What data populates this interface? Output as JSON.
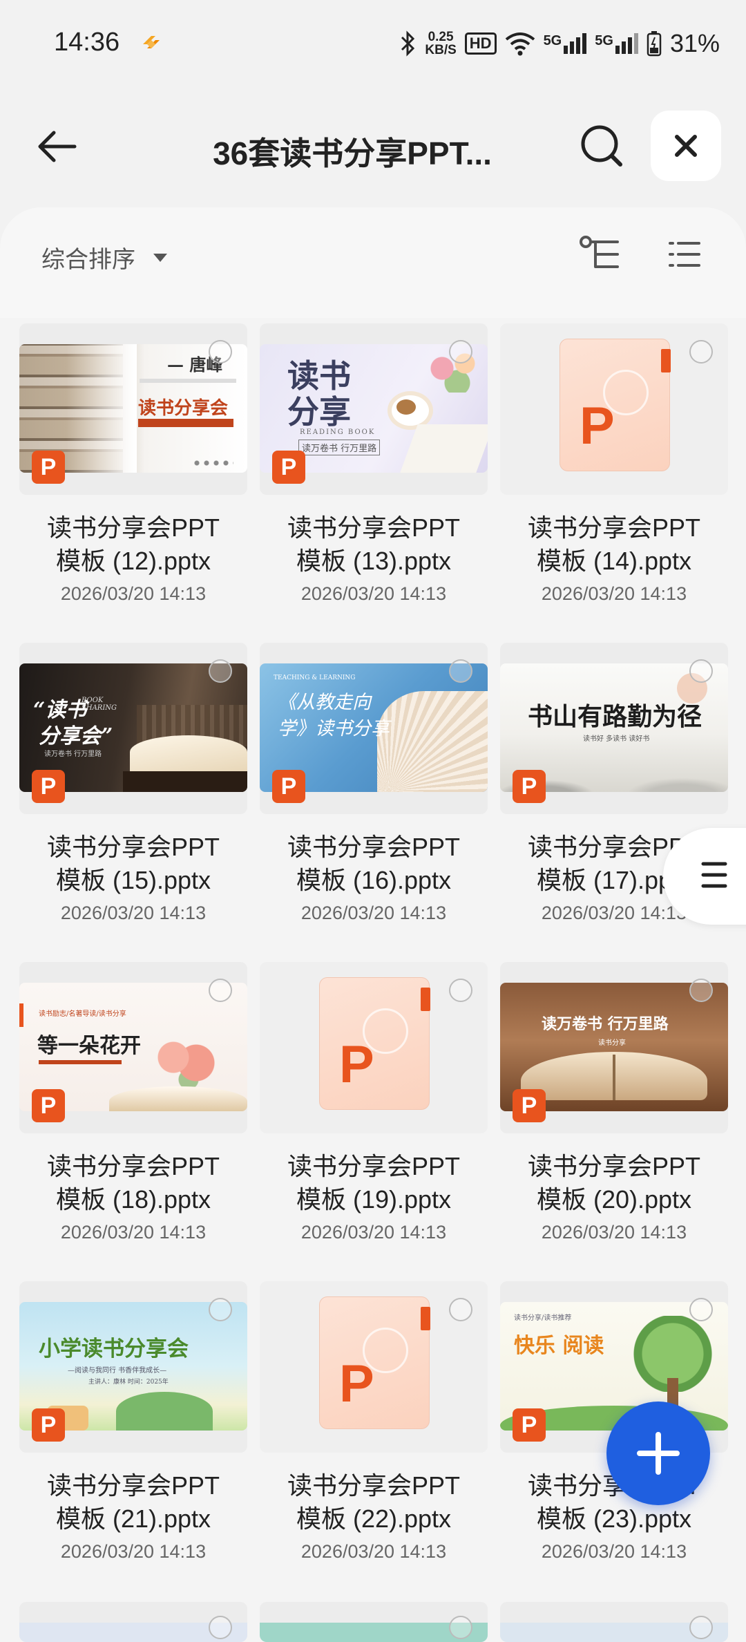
{
  "status": {
    "time": "14:36",
    "speed_value": "0.25",
    "speed_unit": "KB/S",
    "hd": "HD",
    "sig1": "5G",
    "sig2": "5G",
    "battery": "31%"
  },
  "header": {
    "title": "36套读书分享PPT..."
  },
  "toolbar": {
    "sort_label": "综合排序"
  },
  "files": [
    {
      "name_line1": "读书分享会PPT",
      "name_line2": "模板 (12).pptx",
      "date": "2026/03/20 14:13",
      "thumb": "library"
    },
    {
      "name_line1": "读书分享会PPT",
      "name_line2": "模板 (13).pptx",
      "date": "2026/03/20 14:13",
      "thumb": "reading"
    },
    {
      "name_line1": "读书分享会PPT",
      "name_line2": "模板 (14).pptx",
      "date": "2026/03/20 14:13",
      "thumb": "generic"
    },
    {
      "name_line1": "读书分享会PPT",
      "name_line2": "模板 (15).pptx",
      "date": "2026/03/20 14:13",
      "thumb": "dark-book"
    },
    {
      "name_line1": "读书分享会PPT",
      "name_line2": "模板 (16).pptx",
      "date": "2026/03/20 14:13",
      "thumb": "blue-book"
    },
    {
      "name_line1": "读书分享会PPT",
      "name_line2": "模板 (17).pptx",
      "date": "2026/03/20 14:13",
      "thumb": "ink"
    },
    {
      "name_line1": "读书分享会PPT",
      "name_line2": "模板 (18).pptx",
      "date": "2026/03/20 14:13",
      "thumb": "flower"
    },
    {
      "name_line1": "读书分享会PPT",
      "name_line2": "模板 (19).pptx",
      "date": "2026/03/20 14:13",
      "thumb": "generic"
    },
    {
      "name_line1": "读书分享会PPT",
      "name_line2": "模板 (20).pptx",
      "date": "2026/03/20 14:13",
      "thumb": "brown-book"
    },
    {
      "name_line1": "读书分享会PPT",
      "name_line2": "模板 (21).pptx",
      "date": "2026/03/20 14:13",
      "thumb": "kids"
    },
    {
      "name_line1": "读书分享会PPT",
      "name_line2": "模板 (22).pptx",
      "date": "2026/03/20 14:13",
      "thumb": "generic"
    },
    {
      "name_line1": "读书分享会PPT",
      "name_line2": "模板 (23).pptx",
      "date": "2026/03/20 14:13",
      "thumb": "happy"
    }
  ],
  "thumbs_text": {
    "t12_author": "— 唐峰",
    "t12_title": "读书分享会",
    "t13_title1": "读书",
    "t13_title2": "分享",
    "t13_sub": "READING BOOK",
    "t13_slogan": "读万卷书 行万里路",
    "t15_title1": "“读书",
    "t15_title2": "分享会”",
    "t15_en": "BOOK SHARING",
    "t15_sub": "读万卷书 行万里路",
    "t16_title1": "《从教走向",
    "t16_title2": "学》读书分享",
    "t16_en": "TEACHING & LEARNING",
    "t17_title": "书山有路勤为径",
    "t17_sub": "读书好 多读书 读好书",
    "t18_tag": "读书励志/名著导读/读书分享",
    "t18_title": "等一朵花开",
    "t20_title": "读万卷书 行万里路",
    "t20_sub": "读书分享",
    "t21_title": "小学读书分享会",
    "t21_sub": "—阅读与我同行 书香伴我成长—",
    "t21_meta": "主讲人：康林    时间：2025年",
    "t23_tag": "读书分享/读书推荐",
    "t23_title": "快乐 阅读"
  },
  "icons": {
    "accent": "#e8541e",
    "fab_color": "#1f5fe0"
  }
}
